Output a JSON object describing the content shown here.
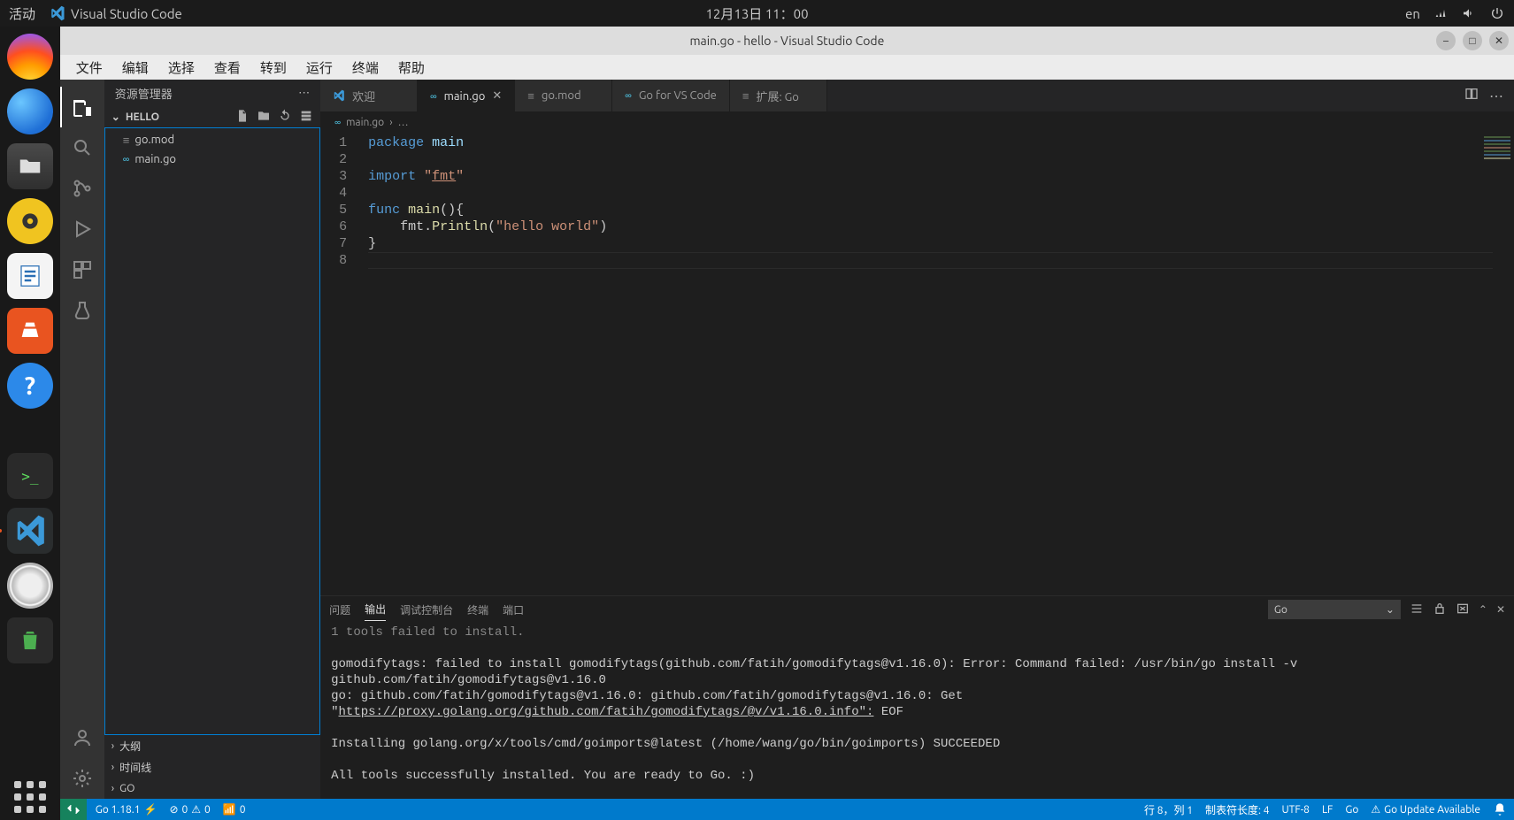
{
  "sysbar": {
    "activity": "活动",
    "app": "Visual Studio Code",
    "clock": "12月13日  11：00",
    "lang": "en"
  },
  "window": {
    "title": "main.go - hello - Visual Studio Code"
  },
  "menubar": [
    "文件",
    "编辑",
    "选择",
    "查看",
    "转到",
    "运行",
    "终端",
    "帮助"
  ],
  "activity_items": [
    "explorer",
    "search",
    "source-control",
    "run-debug",
    "extensions",
    "testing"
  ],
  "sidebar": {
    "title": "资源管理器",
    "project": "HELLO",
    "files": [
      {
        "name": "go.mod",
        "icon": "gomod"
      },
      {
        "name": "main.go",
        "icon": "go"
      }
    ],
    "sections": [
      "大纲",
      "时间线",
      "GO"
    ]
  },
  "tabs": [
    {
      "label": "欢迎",
      "icon": "vscode",
      "active": false,
      "dirty": false
    },
    {
      "label": "main.go",
      "icon": "go",
      "active": true,
      "dirty": false,
      "closable": true
    },
    {
      "label": "go.mod",
      "icon": "gomod",
      "active": false,
      "dirty": false
    },
    {
      "label": "Go for VS Code",
      "icon": "go",
      "active": false,
      "dirty": false
    },
    {
      "label": "扩展: Go",
      "icon": "ext",
      "active": false,
      "dirty": false
    }
  ],
  "breadcrumb": {
    "file": "main.go",
    "tail": "…"
  },
  "code": {
    "lines": [
      {
        "n": 1,
        "html": "<span class='tok-kw'>package</span> <span class='tok-pkg'>main</span>"
      },
      {
        "n": 2,
        "html": ""
      },
      {
        "n": 3,
        "html": "<span class='tok-kw'>import</span> <span class='tok-str'>\"<span class='underline'>fmt</span>\"</span>"
      },
      {
        "n": 4,
        "html": ""
      },
      {
        "n": 5,
        "html": "<span class='tok-kw'>func</span> <span class='tok-fn'>main</span>(){"
      },
      {
        "n": 6,
        "html": "    fmt.<span class='tok-fn'>Println</span>(<span class='tok-str'>\"hello world\"</span>)"
      },
      {
        "n": 7,
        "html": "}"
      },
      {
        "n": 8,
        "html": ""
      }
    ],
    "cursor_line_index": 7
  },
  "panel": {
    "tabs": [
      "问题",
      "输出",
      "调试控制台",
      "终端",
      "端口"
    ],
    "active_tab_index": 1,
    "filter": "Go",
    "output_lines": [
      "1 tools failed to install.",
      "",
      "gomodifytags: failed to install gomodifytags(github.com/fatih/gomodifytags@v1.16.0): Error: Command failed: /usr/bin/go install -v github.com/fatih/gomodifytags@v1.16.0",
      "go: github.com/fatih/gomodifytags@v1.16.0: github.com/fatih/gomodifytags@v1.16.0: Get \"https://proxy.golang.org/github.com/fatih/gomodifytags/@v/v1.16.0.info\": EOF",
      "",
      "Installing golang.org/x/tools/cmd/goimports@latest (/home/wang/go/bin/goimports) SUCCEEDED",
      "",
      "All tools successfully installed. You are ready to Go. :)"
    ]
  },
  "statusbar": {
    "go_version": "Go 1.18.1",
    "errors": "0",
    "warnings": "0",
    "ports": "0",
    "pos": "行 8，列 1",
    "spaces": "制表符长度: 4",
    "encoding": "UTF-8",
    "eol": "LF",
    "lang": "Go",
    "update": "Go Update Available"
  }
}
